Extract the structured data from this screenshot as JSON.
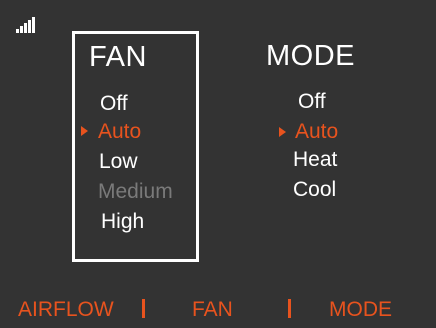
{
  "signal_icon": "signal-strength-icon",
  "accent_color": "#e8531e",
  "fan": {
    "title": "FAN",
    "options": [
      "Off",
      "Auto",
      "Low",
      "Medium",
      "High"
    ],
    "selected": "Auto",
    "disabled": [
      "Medium"
    ]
  },
  "mode": {
    "title": "MODE",
    "options": [
      "Off",
      "Auto",
      "Heat",
      "Cool"
    ],
    "selected": "Auto"
  },
  "footer": {
    "airflow_label": "AIRFLOW",
    "fan_label": "FAN",
    "mode_label": "MODE",
    "separator": "|"
  }
}
